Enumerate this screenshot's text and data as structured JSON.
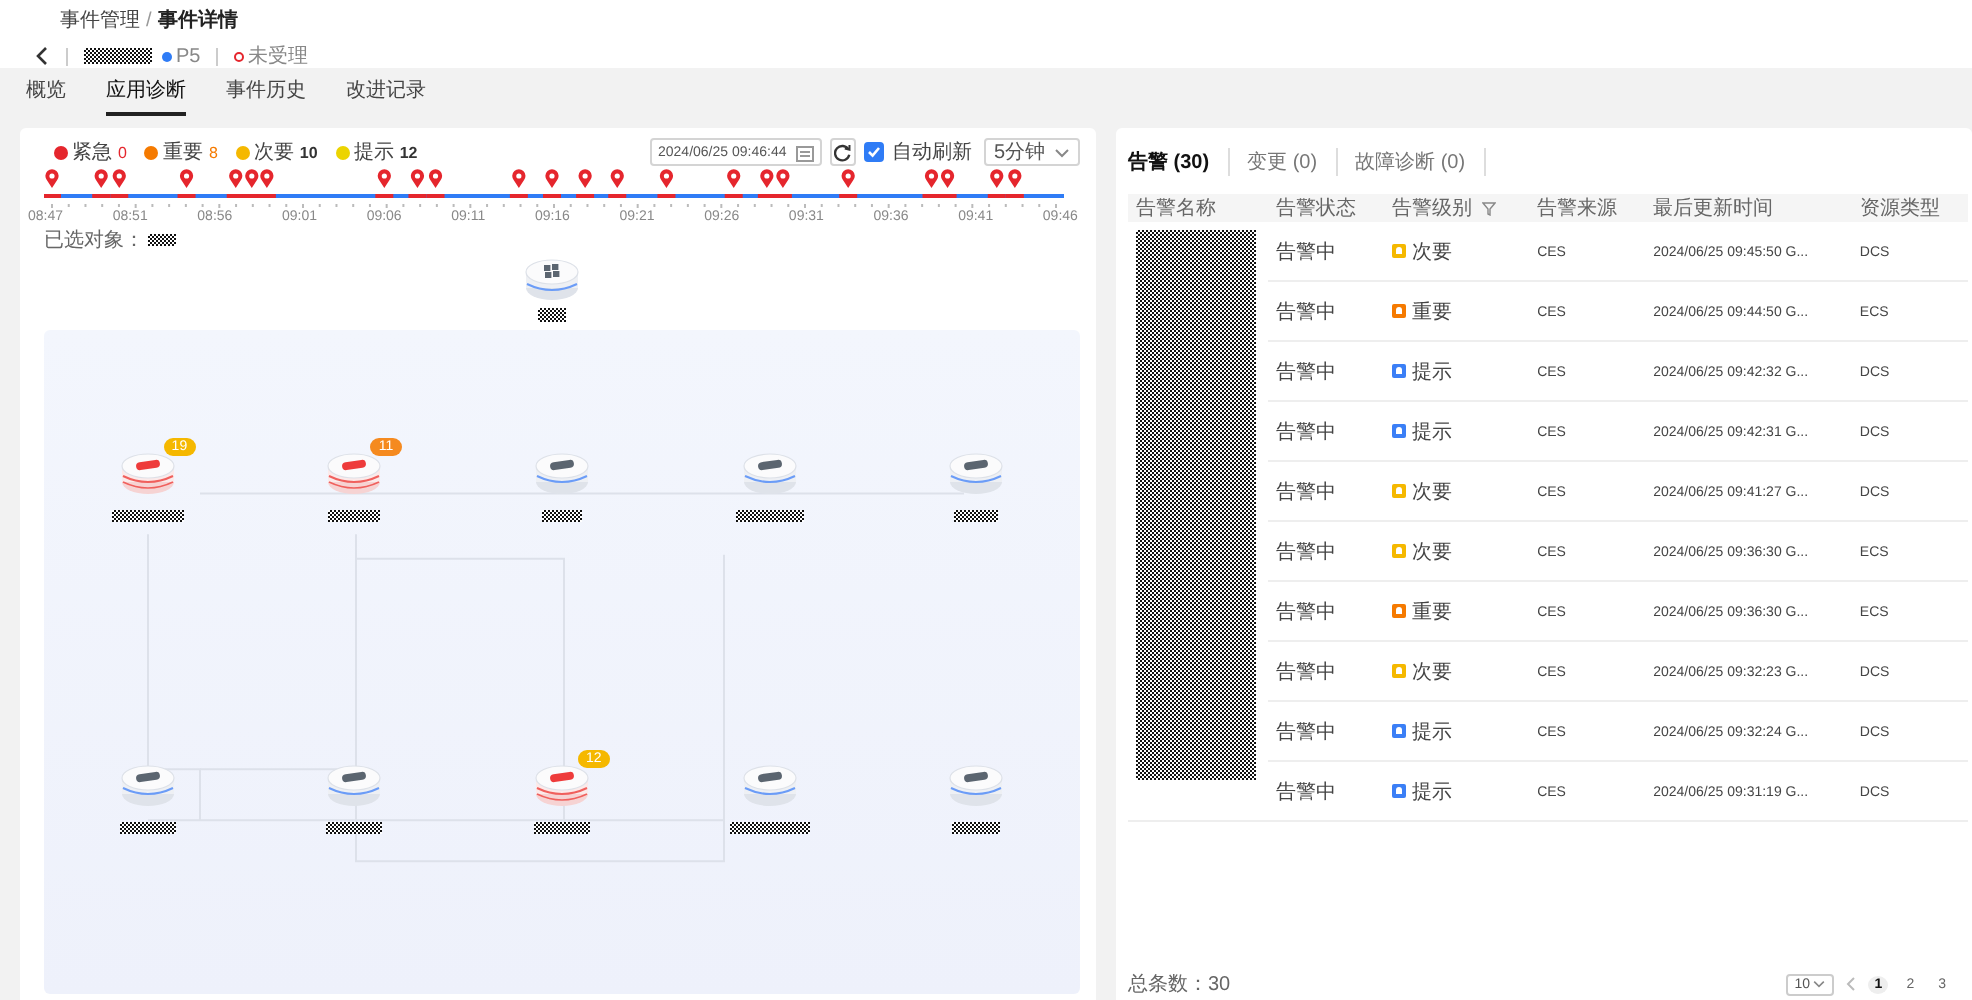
{
  "breadcrumb": [
    "事件管理",
    "事件详情"
  ],
  "breadcrumb_separator": "/",
  "incident": {
    "priority": "P5",
    "status": "未受理"
  },
  "tabs": [
    {
      "label": "概览",
      "selected": false
    },
    {
      "label": "应用诊断",
      "selected": true
    },
    {
      "label": "事件历史",
      "selected": false
    },
    {
      "label": "改进记录",
      "selected": false
    }
  ],
  "legend": [
    {
      "label": "紧急",
      "count": "0",
      "color": "#e5262d",
      "count_colored": true
    },
    {
      "label": "重要",
      "count": "8",
      "color": "#f57a00",
      "count_colored": true
    },
    {
      "label": "次要",
      "count": "10",
      "color": "#f5b800",
      "count_colored": false
    },
    {
      "label": "提示",
      "count": "12",
      "color": "#ecd400",
      "count_colored": false
    }
  ],
  "toolbar": {
    "date": "2024/06/25 09:46:44",
    "auto_refresh": {
      "label": "自动刷新",
      "checked": true
    },
    "interval": "5分钟"
  },
  "timeline": {
    "ticks": [
      "08:47",
      "08:51",
      "08:56",
      "09:01",
      "09:06",
      "09:11",
      "09:16",
      "09:21",
      "09:26",
      "09:31",
      "09:36",
      "09:41",
      "09:46"
    ]
  },
  "selected_object_label": "已选对象：",
  "nodes": [
    {
      "alert": true,
      "badge": "19",
      "color": "#f5b800"
    },
    {
      "alert": true,
      "badge": "11",
      "color": "#f58a1f"
    },
    {
      "alert": false
    },
    {
      "alert": false
    },
    {
      "alert": false
    },
    {
      "alert": false
    },
    {
      "alert": false
    },
    {
      "alert": true,
      "badge": "12",
      "color": "#f5b800"
    },
    {
      "alert": false
    },
    {
      "alert": false
    }
  ],
  "alarm_tabs": [
    {
      "label": "告警",
      "count": "(30)",
      "selected": true
    },
    {
      "label": "变更",
      "count": "(0)",
      "selected": false
    },
    {
      "label": "故障诊断",
      "count": "(0)",
      "selected": false
    }
  ],
  "table": {
    "columns": [
      {
        "label": "告警名称",
        "filter": false
      },
      {
        "label": "告警状态",
        "filter": false
      },
      {
        "label": "告警级别",
        "filter": true
      },
      {
        "label": "告警来源",
        "filter": false
      },
      {
        "label": "最后更新时间",
        "filter": false
      },
      {
        "label": "资源类型",
        "filter": false
      }
    ],
    "rows": [
      {
        "status": "告警中",
        "level": {
          "kind": "minor",
          "label": "次要"
        },
        "source": "CES",
        "time": "2024/06/25 09:45:50 G...",
        "type": "DCS"
      },
      {
        "status": "告警中",
        "level": {
          "kind": "major",
          "label": "重要"
        },
        "source": "CES",
        "time": "2024/06/25 09:44:50 G...",
        "type": "ECS"
      },
      {
        "status": "告警中",
        "level": {
          "kind": "info",
          "label": "提示"
        },
        "source": "CES",
        "time": "2024/06/25 09:42:32 G...",
        "type": "DCS"
      },
      {
        "status": "告警中",
        "level": {
          "kind": "info",
          "label": "提示"
        },
        "source": "CES",
        "time": "2024/06/25 09:42:31 G...",
        "type": "DCS"
      },
      {
        "status": "告警中",
        "level": {
          "kind": "minor",
          "label": "次要"
        },
        "source": "CES",
        "time": "2024/06/25 09:41:27 G...",
        "type": "DCS"
      },
      {
        "status": "告警中",
        "level": {
          "kind": "minor",
          "label": "次要"
        },
        "source": "CES",
        "time": "2024/06/25 09:36:30 G...",
        "type": "ECS"
      },
      {
        "status": "告警中",
        "level": {
          "kind": "major",
          "label": "重要"
        },
        "source": "CES",
        "time": "2024/06/25 09:36:30 G...",
        "type": "ECS"
      },
      {
        "status": "告警中",
        "level": {
          "kind": "minor",
          "label": "次要"
        },
        "source": "CES",
        "time": "2024/06/25 09:32:23 G...",
        "type": "DCS"
      },
      {
        "status": "告警中",
        "level": {
          "kind": "info",
          "label": "提示"
        },
        "source": "CES",
        "time": "2024/06/25 09:32:24 G...",
        "type": "DCS"
      },
      {
        "status": "告警中",
        "level": {
          "kind": "info",
          "label": "提示"
        },
        "source": "CES",
        "time": "2024/06/25 09:31:19 G...",
        "type": "DCS"
      }
    ]
  },
  "footer": {
    "total": "总条数：30",
    "page_size": "10",
    "pages": [
      {
        "label": "1",
        "selected": true
      },
      {
        "label": "2",
        "selected": false
      },
      {
        "label": "3",
        "selected": false
      }
    ]
  }
}
